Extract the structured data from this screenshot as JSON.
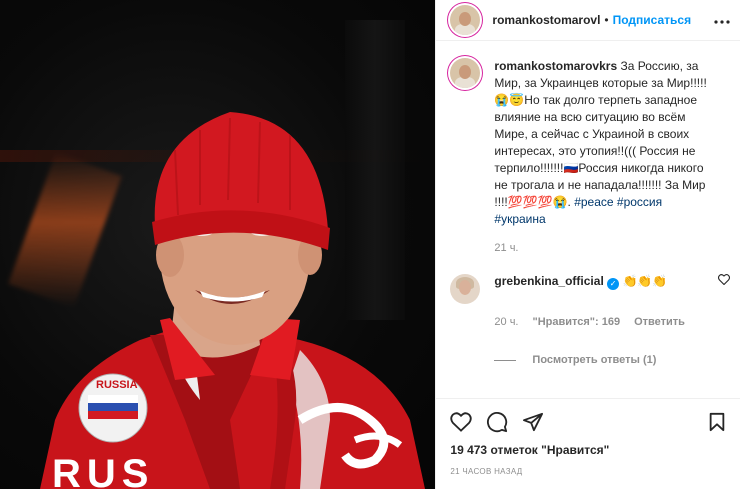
{
  "header": {
    "username": "romankostomarovl",
    "dot": "•",
    "follow_label": "Подписаться",
    "more_label": "•••"
  },
  "media": {
    "patch_text": "RUSSIA",
    "jacket_text": "RUS"
  },
  "caption": {
    "username": "romankostomarovkrs",
    "text": "За Россию, за Мир, за Украинцев которые за Мир!!!!! 😭😇Но так долго терпеть западное влияние на всю ситуацию во всём Мире, а сейчас с Украиной в своих интересах, это утопия!!((( Россия не терпило!!!!!!!🇷🇺Россия никогда никого не трогала и не нападала!!!!!!! За Мир !!!!💯💯💯😭.",
    "tags": [
      "#peace",
      "#россия",
      "#украина"
    ],
    "time": "21 ч."
  },
  "comment": {
    "username": "grebenkina_official",
    "text": "👏👏👏",
    "time": "20 ч.",
    "likes": "\"Нравится\": 169",
    "reply_label": "Ответить",
    "view_replies": "Посмотреть ответы (1)"
  },
  "footer": {
    "likes": "19 473 отметок \"Нравится\"",
    "ago": "21 часов назад"
  },
  "icons": [
    "heart-icon",
    "comment-icon",
    "share-icon",
    "bookmark-icon",
    "more-icon",
    "verified-icon"
  ]
}
